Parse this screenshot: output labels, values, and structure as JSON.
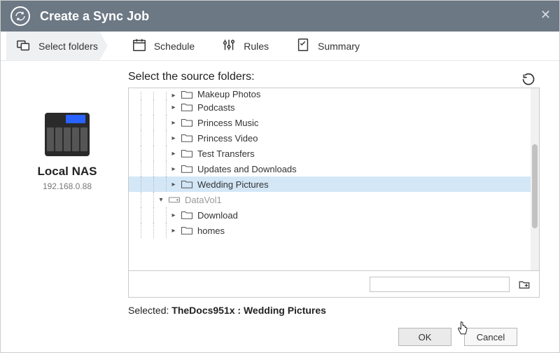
{
  "title": "Create a Sync Job",
  "steps": [
    {
      "label": "Select folders"
    },
    {
      "label": "Schedule"
    },
    {
      "label": "Rules"
    },
    {
      "label": "Summary"
    }
  ],
  "source_label": "Select the source folders:",
  "device": {
    "name": "Local NAS",
    "ip": "192.168.0.88"
  },
  "tree": {
    "items": [
      {
        "label": "Makeup Photos",
        "depth": 3,
        "icon": "folder",
        "selected": false,
        "clipped": true
      },
      {
        "label": "Podcasts",
        "depth": 3,
        "icon": "folder",
        "selected": false
      },
      {
        "label": "Princess Music",
        "depth": 3,
        "icon": "folder",
        "selected": false
      },
      {
        "label": "Princess Video",
        "depth": 3,
        "icon": "folder",
        "selected": false
      },
      {
        "label": "Test Transfers",
        "depth": 3,
        "icon": "folder",
        "selected": false
      },
      {
        "label": "Updates and Downloads",
        "depth": 3,
        "icon": "folder",
        "selected": false
      },
      {
        "label": "Wedding Pictures",
        "depth": 3,
        "icon": "folder",
        "selected": true
      },
      {
        "label": "DataVol1",
        "depth": 2,
        "icon": "drive",
        "selected": false,
        "faded": true,
        "expanded": true
      },
      {
        "label": "Download",
        "depth": 3,
        "icon": "folder",
        "selected": false
      },
      {
        "label": "homes",
        "depth": 3,
        "icon": "folder",
        "selected": false
      }
    ]
  },
  "selected_prefix": "Selected: ",
  "selected_value": "TheDocs951x : Wedding Pictures",
  "buttons": {
    "ok": "OK",
    "cancel": "Cancel"
  }
}
